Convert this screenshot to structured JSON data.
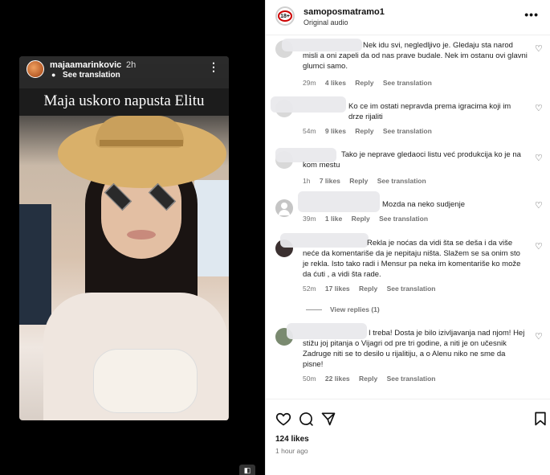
{
  "story": {
    "username": "majaamarinkovic",
    "time": "2h",
    "see_translation": "See translation",
    "caption": "Maja uskoro napusta Elitu"
  },
  "post": {
    "owner": "samoposmatramo1",
    "owner_badge": "18+",
    "audio": "Original audio",
    "likes": "124 likes",
    "time_ago": "1 hour ago"
  },
  "comments": [
    {
      "text": "Nek idu svi, negledljivo je. Gledaju sta narod misli a oni zapeli da od nas prave budale. Nek im ostanu ovi glavni glumci samo.",
      "time": "29m",
      "likes": "4 likes",
      "reply": "Reply",
      "translate": "See translation"
    },
    {
      "text": "Ko ce im ostati nepravda prema igracima koji im drze rijaliti",
      "time": "54m",
      "likes": "9 likes",
      "reply": "Reply",
      "translate": "See translation"
    },
    {
      "text": "Tako je neprave gledaoci listu već produkcija ko je na kom mestu",
      "time": "1h",
      "likes": "7 likes",
      "reply": "Reply",
      "translate": "See translation"
    },
    {
      "text": "Mozda na neko sudjenje",
      "time": "39m",
      "likes": "1 like",
      "reply": "Reply",
      "translate": "See translation"
    },
    {
      "text": "Rekla je noćas da vidi šta se deša i da više neće da komentariše da je nepitaju ništa. Slažem se sa onim sto je rekla. Isto tako radi i Mensur pa neka im komentariše ko može da ćuti , a vidi šta rade.",
      "time": "52m",
      "likes": "17 likes",
      "reply": "Reply",
      "translate": "See translation",
      "view_replies": "View replies (1)"
    },
    {
      "text": "I treba! Dosta je bilo izivljavanja nad njom! Hej stižu joj pitanja o Vijagri od pre tri godine, a niti je on učesnik Zadruge niti se to desilo u rijalitiju, a o Alenu niko ne sme da pisne!",
      "time": "50m",
      "likes": "22 likes",
      "reply": "Reply",
      "translate": "See translation"
    }
  ],
  "icons": {
    "heart": "heart-icon",
    "comment": "comment-icon",
    "share": "share-icon",
    "save": "bookmark-icon",
    "more": "more-icon"
  }
}
